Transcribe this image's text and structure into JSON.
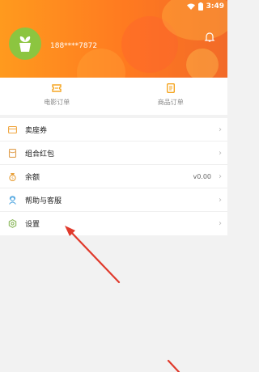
{
  "status": {
    "time": "3:49"
  },
  "profile": {
    "phone": "188****7872"
  },
  "orders": [
    {
      "label": "电影订单",
      "icon": "ticket-icon"
    },
    {
      "label": "商品订单",
      "icon": "receipt-icon"
    }
  ],
  "menu": [
    {
      "label": "卖座券",
      "value": "",
      "icon": "coupon-icon"
    },
    {
      "label": "组合红包",
      "value": "",
      "icon": "red-packet-icon"
    },
    {
      "label": "余额",
      "value": "v0.00",
      "icon": "balance-icon"
    },
    {
      "label": "帮助与客服",
      "value": "",
      "icon": "support-icon"
    },
    {
      "label": "设置",
      "value": "",
      "icon": "settings-icon"
    }
  ],
  "colors": {
    "header": "#ff7a20",
    "accent": "#f5a623",
    "annotation": "#e03a2c"
  }
}
